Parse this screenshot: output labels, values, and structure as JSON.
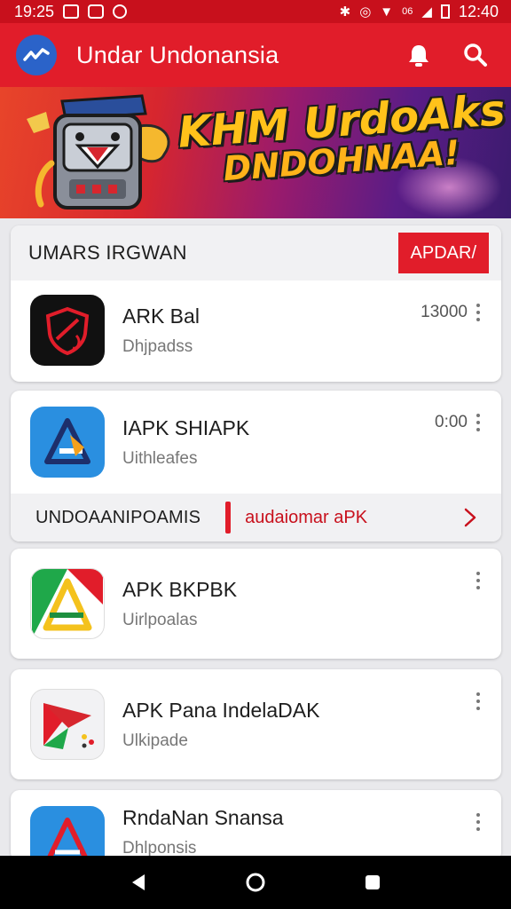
{
  "status_bar": {
    "time_left": "19:25",
    "time_right": "12:40",
    "signal_text": "06"
  },
  "app_bar": {
    "title": "Undar Undonansia"
  },
  "banner": {
    "headline_line1": "KHM UrdoAks",
    "headline_line2": "DNDOHNAA!"
  },
  "section": {
    "title": "UMARS IRGWAN",
    "update_button": "APDAR/"
  },
  "apps": [
    {
      "name": "ARK Bal",
      "sub": "Dhjpadss",
      "meta": "13000",
      "icon": "shield-app-icon"
    },
    {
      "name": "IAPK SHIAPK",
      "sub": "Uithleafes",
      "meta": "0:00",
      "icon": "arrow-app-icon"
    },
    {
      "name": "APK BKPBK",
      "sub": "Uirlpoalas",
      "meta": "",
      "icon": "green-a-app-icon"
    },
    {
      "name": "APK Pana IndelaDAK",
      "sub": "Ulkipade",
      "meta": "",
      "icon": "flag-app-icon"
    },
    {
      "name": "RndaNan Snansa",
      "sub": "Dhlponsis",
      "meta": "",
      "icon": "blue-a-app-icon"
    }
  ],
  "promo": {
    "label": "UNDOAANIPOAMIS",
    "text": "audaiomar aPK"
  },
  "colors": {
    "primary": "#e11d2a",
    "status": "#c8101c",
    "text": "#1d1d1d"
  }
}
